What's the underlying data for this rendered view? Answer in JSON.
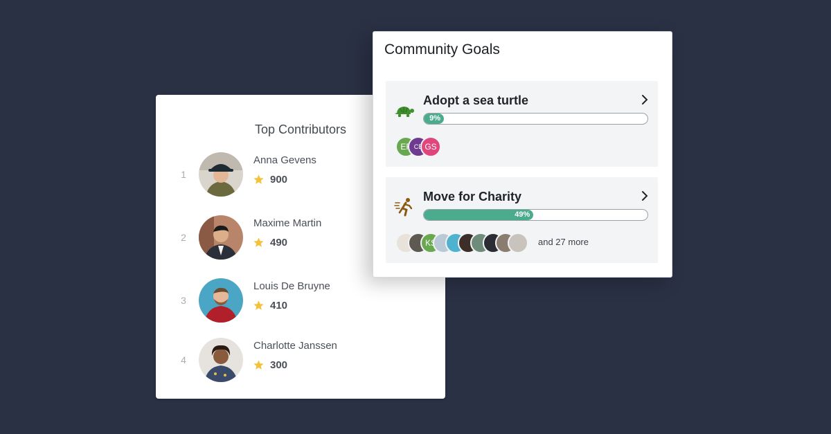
{
  "top_contributors": {
    "title": "Top Contributors",
    "rows": [
      {
        "rank": "1",
        "name": "Anna Gevens",
        "score": "900"
      },
      {
        "rank": "2",
        "name": "Maxime Martin",
        "score": "490"
      },
      {
        "rank": "3",
        "name": "Louis De Bruyne",
        "score": "410"
      },
      {
        "rank": "4",
        "name": "Charlotte Janssen",
        "score": "300"
      }
    ]
  },
  "community_goals": {
    "title": "Community Goals",
    "goals": [
      {
        "name": "Adopt a sea turtle",
        "progress_label": "9%",
        "progress": 0.09,
        "icon": "turtle-icon",
        "participants": [
          {
            "initials": "EF",
            "color": "#6aa84f"
          },
          {
            "initials": "CB",
            "color": "#6d3b8f"
          },
          {
            "initials": "GS",
            "color": "#e0457b"
          }
        ]
      },
      {
        "name": "Move for Charity",
        "progress_label": "49%",
        "progress": 0.49,
        "icon": "running-person-icon",
        "more_label": "and 27 more",
        "participants": [
          {
            "initials": "",
            "color": "#e8e2da"
          },
          {
            "initials": "",
            "color": "#5e5a52"
          },
          {
            "initials": "KS",
            "color": "#6aa84f"
          },
          {
            "initials": "",
            "color": "#b9c9d6"
          },
          {
            "initials": "",
            "color": "#4fb3cf"
          },
          {
            "initials": "",
            "color": "#3c2e28"
          },
          {
            "initials": "",
            "color": "#6f8c7a"
          },
          {
            "initials": "",
            "color": "#2c2c34"
          },
          {
            "initials": "",
            "color": "#8b7c70"
          },
          {
            "initials": "",
            "color": "#c9c3bd"
          }
        ]
      }
    ]
  },
  "colors": {
    "background": "#2a3144",
    "progress": "#4aac8d",
    "star": "#f3c13a",
    "icon_green": "#3f8f2f",
    "icon_brown": "#8a5a12"
  }
}
